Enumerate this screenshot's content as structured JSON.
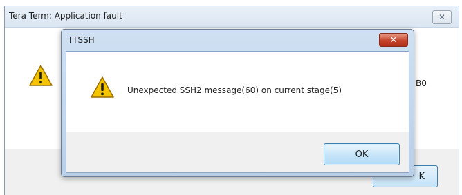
{
  "background_dialog": {
    "title": "Tera Term: Application fault",
    "close_glyph": "✕",
    "partial_message": "B0",
    "ok_label": "K",
    "icon": "warning-icon"
  },
  "foreground_dialog": {
    "title": "TTSSH",
    "close_glyph": "✕",
    "message": "Unexpected SSH2 message(60) on current stage(5)",
    "ok_label": "OK",
    "icon": "warning-icon"
  },
  "colors": {
    "warning_fill": "#f5c400",
    "warning_stroke": "#9a6d00",
    "close_red": "#c7442c",
    "button_border": "#3c7fb1"
  }
}
